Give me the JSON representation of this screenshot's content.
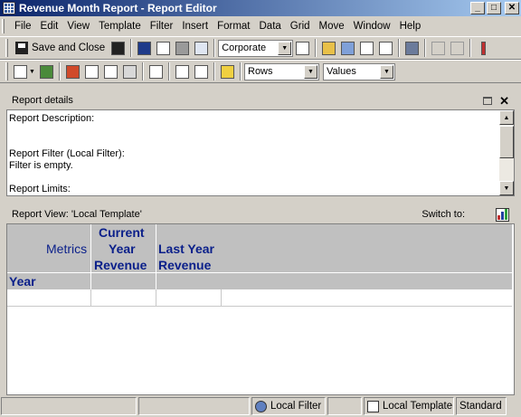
{
  "window": {
    "title": "Revenue Month Report - Report Editor"
  },
  "menu": [
    "File",
    "Edit",
    "View",
    "Template",
    "Filter",
    "Insert",
    "Format",
    "Data",
    "Grid",
    "Move",
    "Window",
    "Help"
  ],
  "toolbar": {
    "save_close_label": "Save and Close",
    "style_select": "Corporate",
    "rows_select": "Rows",
    "values_select": "Values"
  },
  "details": {
    "title": "Report details",
    "description_label": "Report Description:",
    "filter_label": "Report Filter (Local Filter):",
    "filter_value": "Filter is empty.",
    "limits_label": "Report Limits:"
  },
  "view": {
    "title": "Report View: 'Local Template'",
    "switch_to": "Switch to:"
  },
  "grid": {
    "metrics_label": "Metrics",
    "year_label": "Year",
    "col1_line1": "Current",
    "col1_line2": "Year",
    "col1_line3": "Revenue",
    "col2_line1": "Last Year",
    "col2_line2": "Revenue"
  },
  "status": {
    "local_filter": "Local Filter",
    "local_template": "Local Template",
    "standard": "Standard"
  },
  "colors": {
    "title_bar_start": "#0a246a",
    "title_bar_end": "#a6caf0",
    "header_text": "#0a1f8a",
    "grid_header_bg": "#c0c0c0",
    "chrome": "#d4d0c8"
  }
}
